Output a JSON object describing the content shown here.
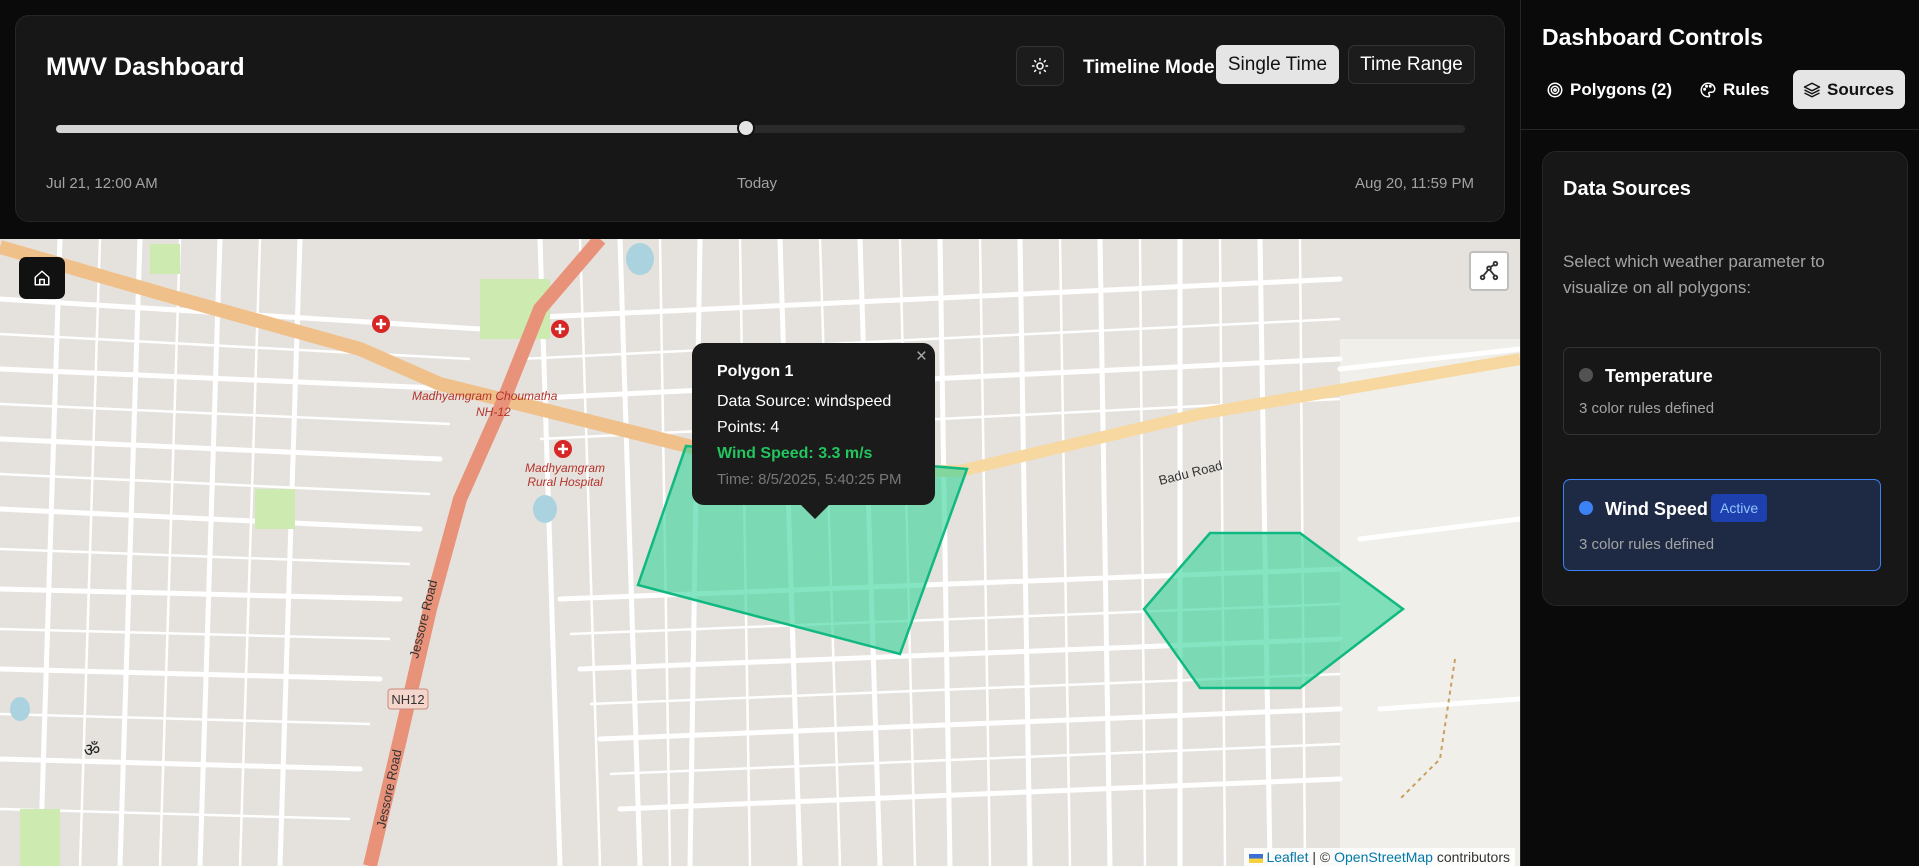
{
  "header": {
    "title": "MWV Dashboard",
    "timeline_label": "Timeline Mode:",
    "single_time_label": "Single Time",
    "time_range_label": "Time Range",
    "slider_value_fraction": 0.49,
    "start_label": "Jul 21, 12:00 AM",
    "mid_label": "Today",
    "end_label": "Aug 20, 11:59 PM"
  },
  "map": {
    "labels": {
      "chowmatha": "Madhyamgram Choumatha",
      "nh12_a": "NH-12",
      "hospital_1": "Madhyamgram",
      "hospital_2": "Rural Hospital",
      "badu_road": "Badu Road",
      "jessore_road": "Jessore Road",
      "jessore_road_2": "Jessore Road",
      "nh12_shield": "NH12",
      "om": "ॐ"
    },
    "popup": {
      "title": "Polygon 1",
      "data_source": "Data Source: windspeed",
      "points": "Points: 4",
      "wind_speed": "Wind Speed: 3.3 m/s",
      "time": "Time: 8/5/2025, 5:40:25 PM",
      "close": "×"
    },
    "attribution": {
      "leaflet": "Leaflet",
      "sep": " | © ",
      "osm": "OpenStreetMap",
      "contributors": " contributors"
    },
    "polygon_color": "#34d399"
  },
  "sidebar": {
    "title": "Dashboard Controls",
    "tabs": {
      "polygons": "Polygons (2)",
      "rules": "Rules",
      "sources": "Sources"
    },
    "data_sources": {
      "title": "Data Sources",
      "description": "Select which weather parameter to visualize on all polygons:",
      "temperature": {
        "name": "Temperature",
        "sub": "3 color rules defined",
        "color": "#525252"
      },
      "wind": {
        "name": "Wind Speed",
        "sub": "3 color rules defined",
        "badge": "Active",
        "color": "#3b82f6"
      }
    }
  }
}
